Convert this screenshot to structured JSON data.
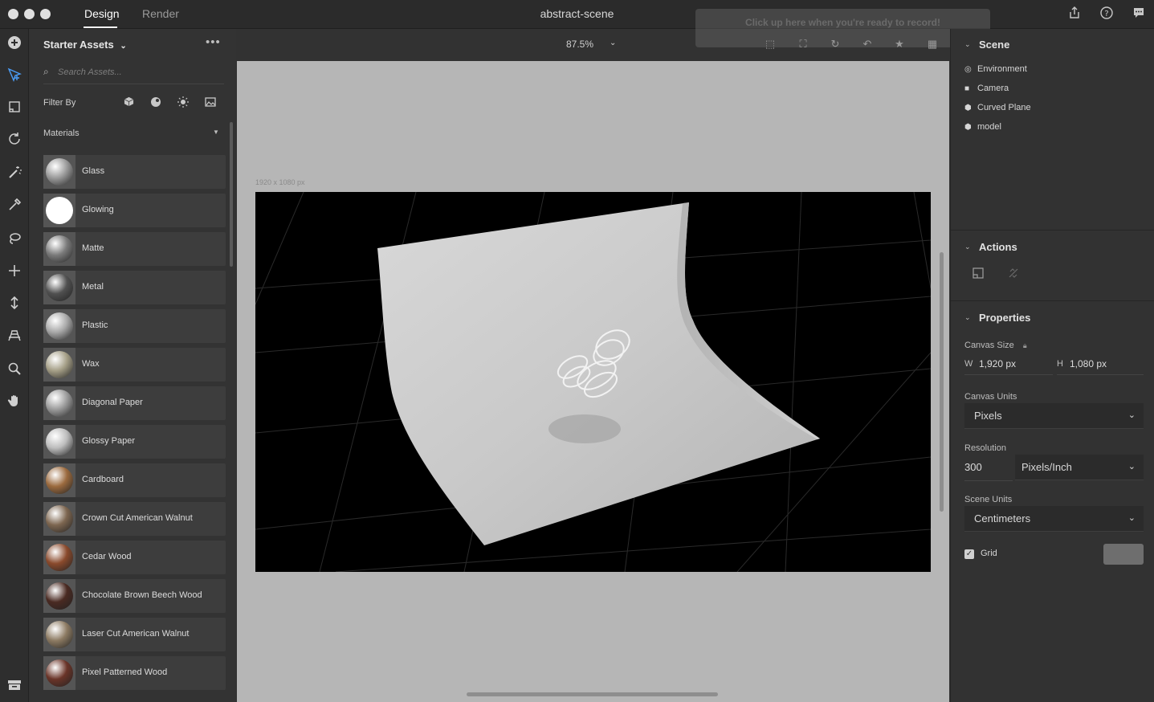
{
  "window": {
    "title": "abstract-scene",
    "tabs": [
      {
        "label": "Design",
        "active": true
      },
      {
        "label": "Render",
        "active": false
      }
    ],
    "top_icons": [
      "share-icon",
      "help-icon",
      "feedback-icon"
    ]
  },
  "record_overlay": {
    "text": "Click up here when you're ready to record!",
    "camera_icons": [
      "frame-icon",
      "fit-camera-icon",
      "orbit-icon",
      "undo-camera-icon",
      "bookmark-camera-icon",
      "render-preview-icon"
    ]
  },
  "toolbar": {
    "tools": [
      "add-icon",
      "select-icon",
      "transform-icon",
      "rotate-icon",
      "magic-wand-icon",
      "eyedropper-icon",
      "lasso-icon",
      "move-icon",
      "vertical-move-icon",
      "orbit-camera-icon",
      "zoom-icon",
      "hand-icon"
    ],
    "active_tool": "select-icon"
  },
  "assets": {
    "title": "Starter Assets",
    "search_placeholder": "Search Assets...",
    "filter_label": "Filter By",
    "category": "Materials",
    "materials": [
      {
        "label": "Glass",
        "color": "#9a9a9a"
      },
      {
        "label": "Glowing",
        "color": "#ffffff"
      },
      {
        "label": "Matte",
        "color": "#7a7a7a"
      },
      {
        "label": "Metal",
        "color": "#505050"
      },
      {
        "label": "Plastic",
        "color": "#a8a8a8"
      },
      {
        "label": "Wax",
        "color": "#a49e86"
      },
      {
        "label": "Diagonal Paper",
        "color": "#9c9c9c"
      },
      {
        "label": "Glossy Paper",
        "color": "#bdbdbd"
      },
      {
        "label": "Cardboard",
        "color": "#9b6a3e"
      },
      {
        "label": "Crown Cut American Walnut",
        "color": "#7d6650"
      },
      {
        "label": "Cedar Wood",
        "color": "#8a4a2c"
      },
      {
        "label": "Chocolate Brown Beech Wood",
        "color": "#4a2a22"
      },
      {
        "label": "Laser Cut American Walnut",
        "color": "#8c7a62"
      },
      {
        "label": "Pixel Patterned Wood",
        "color": "#6a3428"
      }
    ]
  },
  "viewport": {
    "zoom": "87.5%",
    "canvas_dims": "1920 x 1080 px"
  },
  "scene": {
    "title": "Scene",
    "items": [
      {
        "label": "Environment",
        "icon": "environment-icon"
      },
      {
        "label": "Camera",
        "icon": "camera-icon"
      },
      {
        "label": "Curved Plane",
        "icon": "object-icon"
      },
      {
        "label": "model",
        "icon": "object-icon"
      }
    ]
  },
  "actions": {
    "title": "Actions"
  },
  "properties": {
    "title": "Properties",
    "canvas_size_label": "Canvas Size",
    "width_label": "W",
    "width_value": "1,920 px",
    "height_label": "H",
    "height_value": "1,080 px",
    "canvas_units_label": "Canvas Units",
    "canvas_units_value": "Pixels",
    "resolution_label": "Resolution",
    "resolution_value": "300",
    "resolution_units_value": "Pixels/Inch",
    "scene_units_label": "Scene Units",
    "scene_units_value": "Centimeters",
    "grid_label": "Grid",
    "grid_checked": true
  }
}
